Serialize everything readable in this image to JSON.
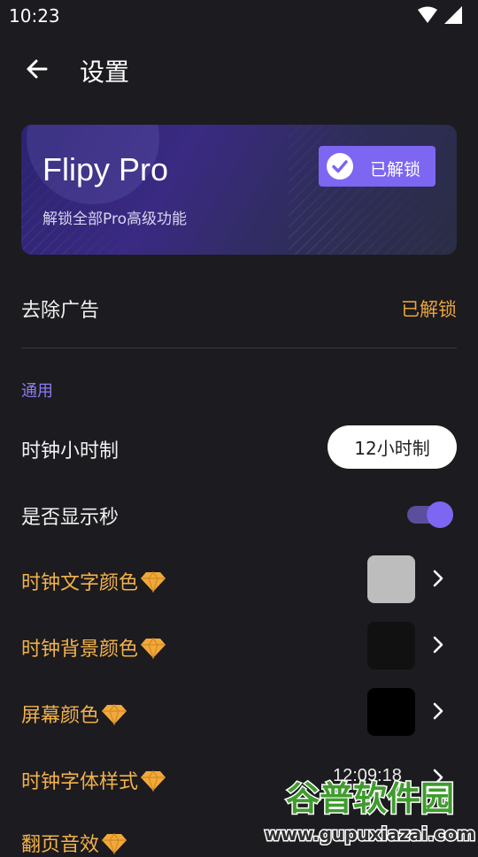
{
  "status": {
    "time": "10:23"
  },
  "app_bar": {
    "title": "设置"
  },
  "pro_card": {
    "title": "Flipy Pro",
    "subtitle": "解锁全部Pro高级功能",
    "badge_label": "已解锁"
  },
  "remove_ads": {
    "label": "去除广告",
    "value": "已解锁"
  },
  "section": {
    "general": "通用"
  },
  "settings": {
    "clock_hour_format": {
      "label": "时钟小时制",
      "value": "12小时制"
    },
    "show_seconds": {
      "label": "是否显示秒",
      "enabled": true
    },
    "clock_text_color": {
      "label": "时钟文字颜色",
      "swatch_color": "#bdbdbd"
    },
    "clock_bg_color": {
      "label": "时钟背景颜色",
      "swatch_color": "#111111"
    },
    "screen_color": {
      "label": "屏幕颜色",
      "swatch_color": "#000000"
    },
    "clock_font_style": {
      "label": "时钟字体样式",
      "preview": "12:09:18"
    },
    "flip_sound": {
      "label": "翻页音效"
    }
  },
  "watermark": {
    "text_top": "谷普软件园",
    "text_bottom": "www.gupuxiazai.com"
  },
  "colors": {
    "accent": "#7c66f2",
    "gold": "#f2b24b",
    "background": "#1c1b1f"
  }
}
